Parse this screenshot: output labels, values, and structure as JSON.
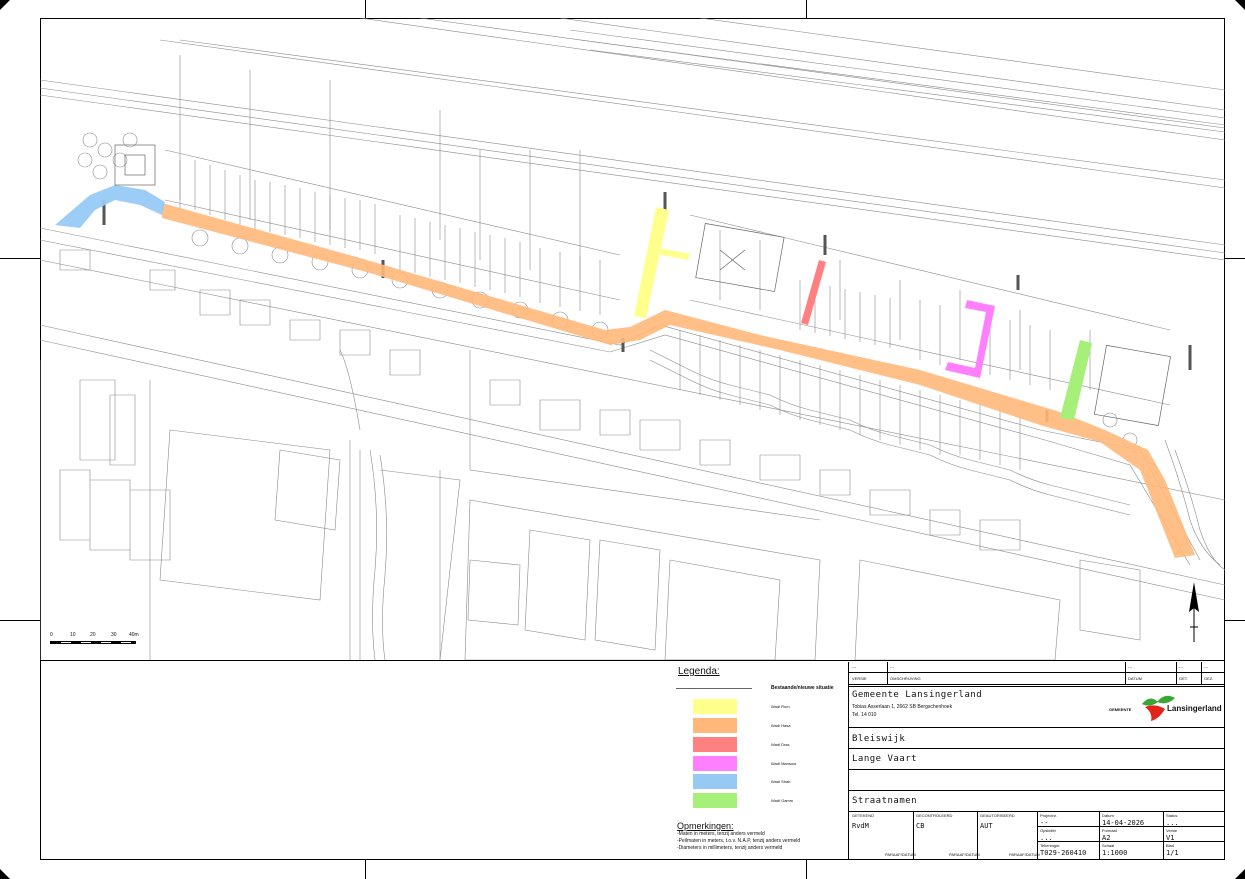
{
  "legend": {
    "title": "Legenda:",
    "subtitle": "Bestaande/nieuwe situatie",
    "items": [
      {
        "label": "Wadi Rum",
        "color": "#ffff8c"
      },
      {
        "label": "Wadi Hasa",
        "color": "#ffb87a"
      },
      {
        "label": "Wadi Dras",
        "color": "#ff8080"
      },
      {
        "label": "Wadi Mansour",
        "color": "#ff80ff"
      },
      {
        "label": "Wadi Shab",
        "color": "#96caf5"
      },
      {
        "label": "Wadi Gamm",
        "color": "#a6f07a"
      }
    ]
  },
  "remarks": {
    "title": "Opmerkingen:",
    "lines": [
      "-Maten in meters, tenzij anders vermeld",
      "-Peilmaten in meters, t.o.v. N.A.P, tenzij anders vermeld",
      "-Diameters in millimeters, tenzij anders vermeld"
    ]
  },
  "scalebar": {
    "labels": [
      "0",
      "10",
      "20",
      "30",
      "40m"
    ]
  },
  "titleblock": {
    "rev_row": {
      "c1": "...",
      "c2": "...",
      "c3": "...",
      "c4": "...",
      "c5": "..."
    },
    "headers": {
      "versie": "VERSIE",
      "omschrijving": "OMSCHRIJVING",
      "datum": "DATUM",
      "get": "GET.",
      "gez": "GEZ."
    },
    "org": "Gemeente Lansingerland",
    "address": "Tobias Asserlaan 1, 2662 SB Bergschenhoek",
    "tel": "Tel. 14 010",
    "logo_small": "GEMEENTE",
    "logo_text": "Lansingerland",
    "place": "Bleiswijk",
    "street": "Lange Vaart",
    "subject": "Straatnamen",
    "fields": {
      "getekend_label": "GETEKEND",
      "getekend": "RvdM",
      "gecontroleerd_label": "GECONTROLEERD",
      "gecontroleerd": "CB",
      "geautoriseerd_label": "GEAUTORISEERD",
      "geautoriseerd": "AUT",
      "paraaf1": "PARAAF/DATUM",
      "paraaf2": "PARAAF/DATUM",
      "paraaf3": "PARAAF/DATUM",
      "projectnr_label": "Projectnr.",
      "projectnr": "--",
      "datum_label": "Datum",
      "datum": "14-04-2026",
      "status_label": "Status",
      "status": "...",
      "opsteller_label": "Opsteller",
      "opsteller": "...",
      "formaat_label": "Formaat",
      "formaat": "A2",
      "versie_label": "Versie",
      "versie": "V1",
      "tekening_label": "Tekeningnr.",
      "tekening": "T029-260410",
      "schaal_label": "Schaal",
      "schaal": "1:1000",
      "blad_label": "Blad",
      "blad": "1/1"
    }
  }
}
